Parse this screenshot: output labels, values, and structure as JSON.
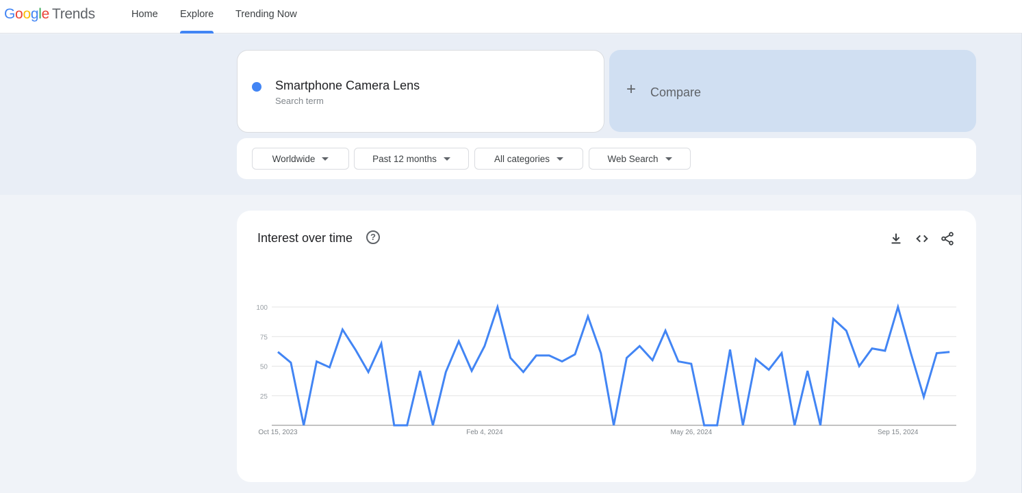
{
  "header": {
    "logo_parts": [
      "G",
      "o",
      "o",
      "g",
      "l",
      "e"
    ],
    "logo_product": "Trends",
    "nav": [
      {
        "label": "Home",
        "active": false
      },
      {
        "label": "Explore",
        "active": true
      },
      {
        "label": "Trending Now",
        "active": false
      }
    ]
  },
  "search": {
    "term": "Smartphone Camera Lens",
    "term_type": "Search term",
    "term_color": "#4285f4",
    "compare_icon": "+",
    "compare_label": "Compare"
  },
  "filters": [
    {
      "label": "Worldwide"
    },
    {
      "label": "Past 12 months"
    },
    {
      "label": "All categories"
    },
    {
      "label": "Web Search"
    }
  ],
  "chart_panel": {
    "title": "Interest over time",
    "help_icon": "?",
    "tools": [
      "download-icon",
      "embed-code-icon",
      "share-icon"
    ]
  },
  "chart_data": {
    "type": "line",
    "title": "Interest over time",
    "xlabel": "",
    "ylabel": "",
    "ylim": [
      0,
      100
    ],
    "yticks": [
      25,
      50,
      75,
      100
    ],
    "grid": true,
    "legend": "none",
    "series_color": "#4285f4",
    "start_date": "Oct 15, 2023",
    "interval": "weekly",
    "xtick_labels": [
      {
        "index": 0,
        "label": "Oct 15, 2023"
      },
      {
        "index": 16,
        "label": "Feb 4, 2024"
      },
      {
        "index": 32,
        "label": "May 26, 2024"
      },
      {
        "index": 48,
        "label": "Sep 15, 2024"
      }
    ],
    "series": [
      {
        "name": "Smartphone Camera Lens",
        "values": [
          62,
          53,
          0,
          54,
          49,
          81,
          64,
          45,
          69,
          0,
          0,
          46,
          0,
          45,
          71,
          46,
          67,
          100,
          57,
          45,
          59,
          59,
          54,
          60,
          92,
          61,
          0,
          57,
          67,
          55,
          80,
          54,
          52,
          0,
          0,
          64,
          0,
          56,
          47,
          61,
          0,
          46,
          0,
          90,
          80,
          50,
          65,
          63,
          100,
          61,
          24,
          61,
          62
        ]
      }
    ]
  }
}
